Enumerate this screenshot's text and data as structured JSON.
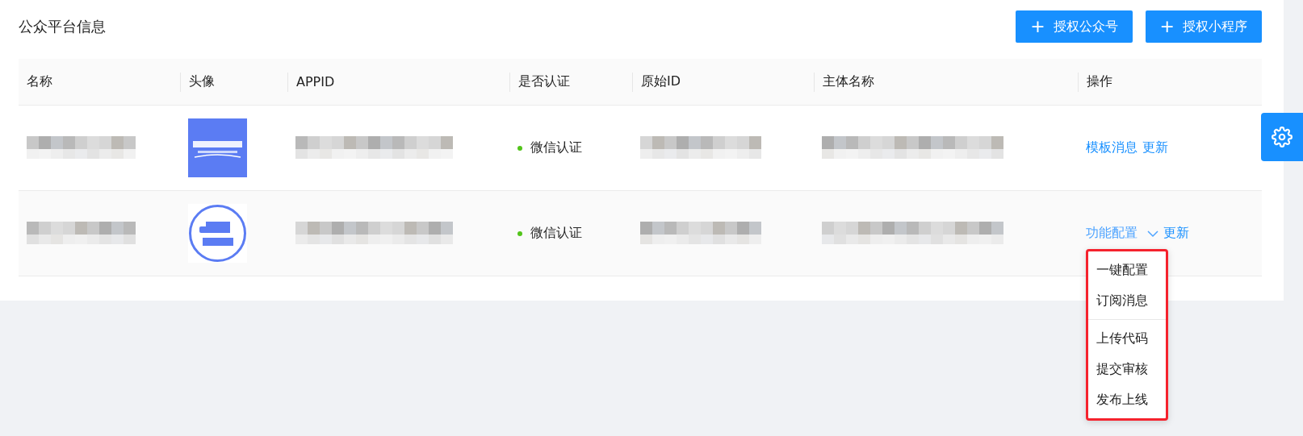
{
  "title": "公众平台信息",
  "buttons": [
    {
      "icon": "+",
      "label": "授权公众号"
    },
    {
      "icon": "+",
      "label": "授权小程序"
    }
  ],
  "table": {
    "columns": [
      "名称",
      "头像",
      "APPID",
      "是否认证",
      "原始ID",
      "主体名称",
      "操作"
    ],
    "rows": [
      {
        "name": {
          "kind": "pixelated"
        },
        "avatar": {
          "kind": "picture"
        },
        "appid": {
          "kind": "pixelated"
        },
        "verification": "微信认证",
        "original_id": {
          "kind": "pixelated"
        },
        "entity": {
          "kind": "pixelated"
        },
        "actions": [
          {
            "kind": "link",
            "label": "模板消息"
          },
          {
            "kind": "link",
            "label": "更新"
          }
        ]
      },
      {
        "name": {
          "kind": "pixelated"
        },
        "avatar": {
          "kind": "picture"
        },
        "appid": {
          "kind": "pixelated"
        },
        "verification": "微信认证",
        "original_id": {
          "kind": "pixelated"
        },
        "entity": {
          "kind": "pixelated"
        },
        "actions": [
          {
            "kind": "dropdown",
            "label": "功能配置",
            "expanded": true,
            "menu": [
              [
                "一键配置",
                "订阅消息"
              ],
              [
                "上传代码",
                "提交审核",
                "发布上线"
              ]
            ]
          },
          {
            "kind": "link",
            "label": "更新"
          }
        ]
      }
    ]
  }
}
